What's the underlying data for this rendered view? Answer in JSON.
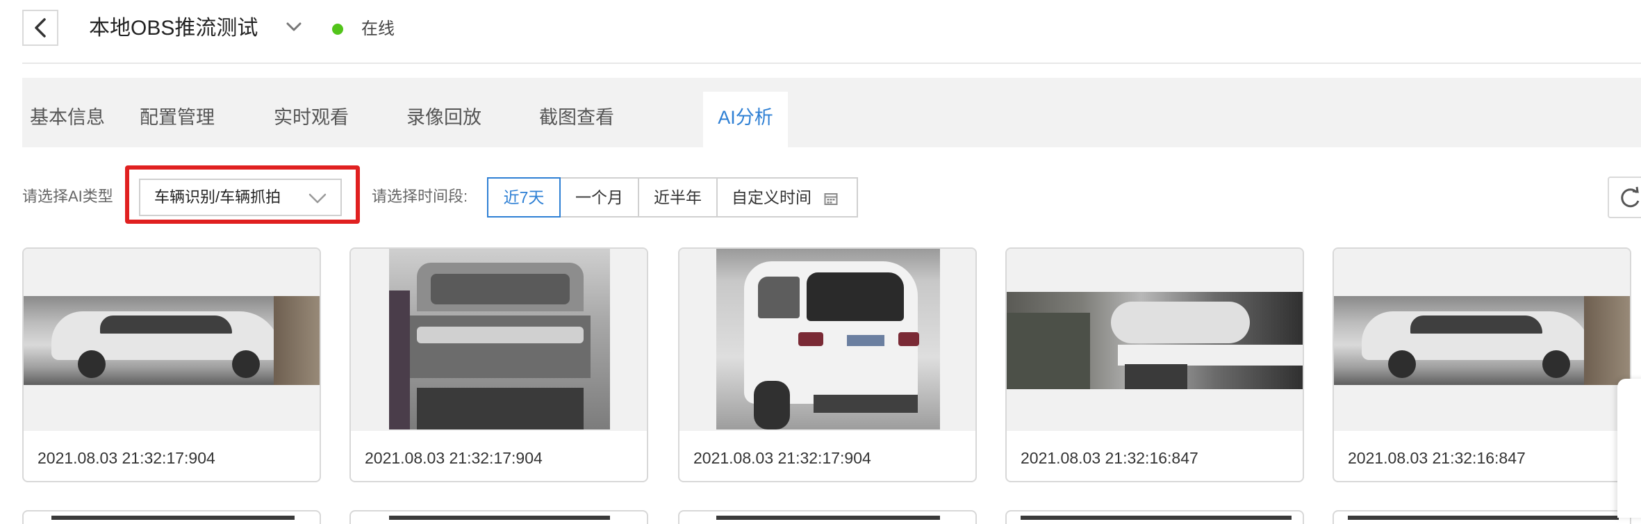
{
  "header": {
    "title": "本地OBS推流测试",
    "status": "在线",
    "status_color": "#52c41a"
  },
  "tabs": [
    {
      "label": "基本信息",
      "active": false
    },
    {
      "label": "配置管理",
      "active": false
    },
    {
      "label": "实时观看",
      "active": false
    },
    {
      "label": "录像回放",
      "active": false
    },
    {
      "label": "截图查看",
      "active": false
    },
    {
      "label": "AI分析",
      "active": true
    }
  ],
  "filters": {
    "ai_type_label": "请选择AI类型",
    "ai_type_value": "车辆识别/车辆抓拍",
    "time_label": "请选择时间段:",
    "time_options": [
      {
        "label": "近7天",
        "active": true
      },
      {
        "label": "一个月",
        "active": false
      },
      {
        "label": "近半年",
        "active": false
      },
      {
        "label": "自定义时间",
        "active": false
      }
    ]
  },
  "cards": [
    {
      "time": "2021.08.03 21:32:17:904"
    },
    {
      "time": "2021.08.03 21:32:17:904"
    },
    {
      "time": "2021.08.03 21:32:17:904"
    },
    {
      "time": "2021.08.03 21:32:16:847"
    },
    {
      "time": "2021.08.03 21:32:16:847"
    }
  ],
  "colors": {
    "accent": "#2d7fd4",
    "highlight": "#e02020"
  },
  "icons": {
    "back": "chevron-left-icon",
    "title_dropdown": "chevron-down-icon",
    "select_dropdown": "chevron-down-icon",
    "calendar": "calendar-icon",
    "refresh": "refresh-icon"
  }
}
